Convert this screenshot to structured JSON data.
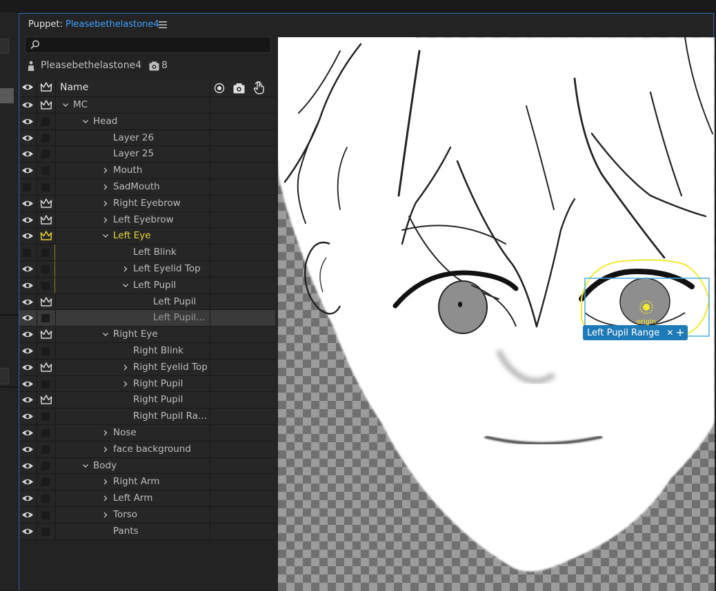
{
  "panel": {
    "title_label": "Puppet:",
    "title_name": "Pleasebethelastone4"
  },
  "search": {
    "placeholder": ""
  },
  "puppet_info": {
    "name": "Pleasebethelastone4",
    "count": "8"
  },
  "columns": {
    "name": "Name"
  },
  "layers": [
    {
      "label": "MC",
      "indent": 0,
      "chevron": "down",
      "eye": true,
      "crown": true
    },
    {
      "label": "Head",
      "indent": 1,
      "chevron": "down",
      "eye": true,
      "crown": false
    },
    {
      "label": "Layer 26",
      "indent": 2,
      "chevron": "none",
      "eye": true,
      "crown": false
    },
    {
      "label": "Layer 25",
      "indent": 2,
      "chevron": "none",
      "eye": true,
      "crown": false
    },
    {
      "label": "Mouth",
      "indent": 2,
      "chevron": "right",
      "eye": true,
      "crown": false
    },
    {
      "label": "SadMouth",
      "indent": 2,
      "chevron": "right",
      "eye": false,
      "crown": false
    },
    {
      "label": "Right Eyebrow",
      "indent": 2,
      "chevron": "right",
      "eye": true,
      "crown": true
    },
    {
      "label": "Left Eyebrow",
      "indent": 2,
      "chevron": "right",
      "eye": true,
      "crown": true
    },
    {
      "label": "Left Eye",
      "indent": 2,
      "chevron": "down",
      "eye": true,
      "crown": true,
      "highlight": true
    },
    {
      "label": "Left Blink",
      "indent": 3,
      "chevron": "none",
      "eye": false,
      "crown": false,
      "yline": true
    },
    {
      "label": "Left Eyelid Top",
      "indent": 3,
      "chevron": "right",
      "eye": true,
      "crown": false,
      "yline": true
    },
    {
      "label": "Left Pupil",
      "indent": 3,
      "chevron": "down",
      "eye": true,
      "crown": false,
      "yline": true
    },
    {
      "label": "Left Pupil",
      "indent": 4,
      "chevron": "none",
      "eye": true,
      "crown": true
    },
    {
      "label": "Left Pupil...",
      "indent": 4,
      "chevron": "none",
      "eye": true,
      "crown": false,
      "selected": true
    },
    {
      "label": "Right Eye",
      "indent": 2,
      "chevron": "down",
      "eye": true,
      "crown": true
    },
    {
      "label": "Right Blink",
      "indent": 3,
      "chevron": "none",
      "eye": true,
      "crown": false
    },
    {
      "label": "Right Eyelid Top",
      "indent": 3,
      "chevron": "right",
      "eye": true,
      "crown": true
    },
    {
      "label": "Right Pupil",
      "indent": 3,
      "chevron": "right",
      "eye": true,
      "crown": false
    },
    {
      "label": "Right Pupil",
      "indent": 3,
      "chevron": "none",
      "eye": true,
      "crown": true
    },
    {
      "label": "Right Pupil Ra...",
      "indent": 3,
      "chevron": "none",
      "eye": true,
      "crown": false
    },
    {
      "label": "Nose",
      "indent": 2,
      "chevron": "right",
      "eye": true,
      "crown": false
    },
    {
      "label": "face background",
      "indent": 2,
      "chevron": "right",
      "eye": true,
      "crown": false
    },
    {
      "label": "Body",
      "indent": 1,
      "chevron": "down",
      "eye": true,
      "crown": false
    },
    {
      "label": "Right Arm",
      "indent": 2,
      "chevron": "right",
      "eye": true,
      "crown": false
    },
    {
      "label": "Left Arm",
      "indent": 2,
      "chevron": "right",
      "eye": true,
      "crown": false
    },
    {
      "label": "Torso",
      "indent": 2,
      "chevron": "right",
      "eye": true,
      "crown": false
    },
    {
      "label": "Pants",
      "indent": 2,
      "chevron": "none",
      "eye": true,
      "crown": false
    }
  ],
  "viewport": {
    "origin_label": "origin",
    "range_tag": "Left Pupil Range",
    "range_close": "✕",
    "range_add": "+"
  },
  "colors": {
    "accent": "#3fa2ff",
    "highlight": "#e8d43a",
    "tag": "#1f7bb8",
    "bounding_box": "#4aa8e8",
    "range_outline": "#f2ea2a"
  }
}
